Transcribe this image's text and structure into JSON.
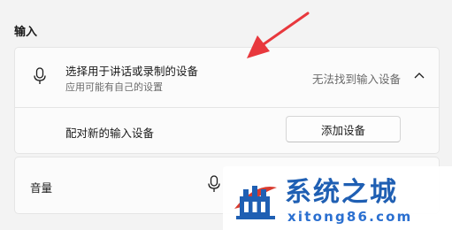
{
  "section": {
    "title": "输入"
  },
  "input_card": {
    "title": "选择用于讲话或录制的设备",
    "subtitle": "应用可能有自己的设置",
    "status": "无法找到输入设备",
    "mic_icon": "microphone-icon",
    "expand_icon": "chevron-up-icon"
  },
  "pair_row": {
    "label": "配对新的输入设备",
    "button_label": "添加设备"
  },
  "volume_row": {
    "label": "音量",
    "mic_icon": "microphone-icon"
  },
  "annotation": {
    "icon": "red-arrow-icon",
    "color": "#e8383d"
  },
  "watermark": {
    "title": "系统之城",
    "url": "xitong86.com",
    "logo_icon": "castle-logo-icon",
    "color": "#1f5fb3"
  },
  "colors": {
    "background": "#f3f3f3",
    "card": "#fbfbfb",
    "border": "#e5e5e5",
    "secondary_text": "#6b6b6b"
  }
}
